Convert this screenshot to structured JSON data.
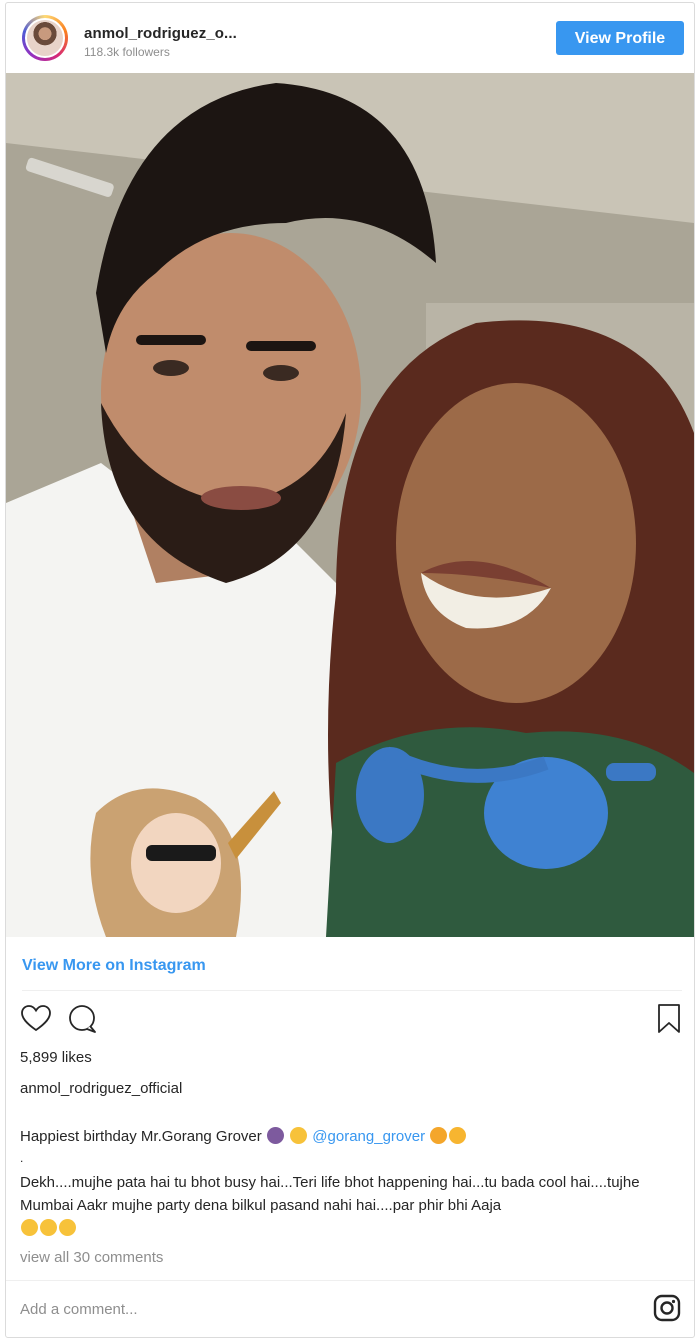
{
  "header": {
    "username": "anmol_rodriguez_o...",
    "followers": "118.3k followers",
    "view_profile_label": "View Profile"
  },
  "links": {
    "view_more": "View More on Instagram"
  },
  "actions": {
    "icons": [
      "heart-icon",
      "comment-icon",
      "bookmark-icon"
    ]
  },
  "stats": {
    "likes": "5,899 likes"
  },
  "caption": {
    "username": "anmol_rodriguez_official",
    "line1_text": "Happiest birthday Mr.Gorang Grover",
    "mention": "@gorang_grover",
    "dot": ".",
    "body": "Dekh....mujhe pata hai tu bhot busy hai...Teri life bhot happening hai...tu bada cool hai....tujhe Mumbai Aakr mujhe party dena bilkul pasand nahi hai....par phir bhi Aaja"
  },
  "comments": {
    "view_all": "view all 30 comments",
    "add_placeholder": "Add a comment..."
  },
  "colors": {
    "accent": "#3897f0",
    "text": "#262626",
    "muted": "#8e8e8e",
    "border": "#dbdbdb"
  }
}
